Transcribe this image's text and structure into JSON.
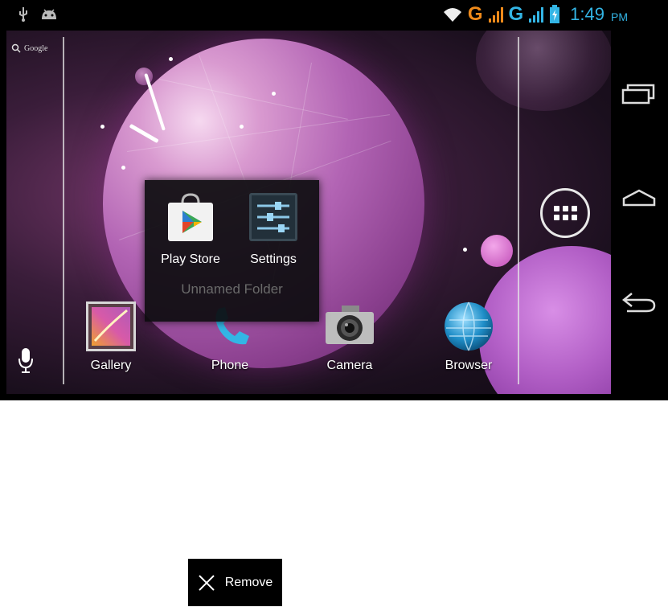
{
  "status_bar": {
    "icons": [
      "usb-icon",
      "android-debug-icon",
      "wifi-icon",
      "signal-icon",
      "signal-icon",
      "battery-charging-icon"
    ],
    "network_1": "G",
    "network_2": "G",
    "time": "1:49",
    "ampm": "PM"
  },
  "home": {
    "search_label": "Google",
    "apps_button_icon": "all-apps-icon"
  },
  "folder": {
    "name": "Unnamed Folder",
    "items": [
      {
        "label": "Play Store",
        "icon": "play-store-icon"
      },
      {
        "label": "Settings",
        "icon": "settings-icon"
      }
    ]
  },
  "dock": {
    "items": [
      {
        "label": "Gallery",
        "icon": "gallery-icon"
      },
      {
        "label": "Phone",
        "icon": "phone-icon"
      },
      {
        "label": "Camera",
        "icon": "camera-icon"
      },
      {
        "label": "Browser",
        "icon": "browser-icon"
      }
    ]
  },
  "navbar": {
    "buttons": [
      "recent-apps-icon",
      "home-icon",
      "back-icon"
    ]
  },
  "remove_bar": {
    "label": "Remove",
    "icon": "close-icon"
  },
  "colors": {
    "accent_blue": "#33b5e5",
    "network_orange": "#f08a1a",
    "folder_bg": "#0c0c0e",
    "folder_name": "#6a6a6a"
  }
}
